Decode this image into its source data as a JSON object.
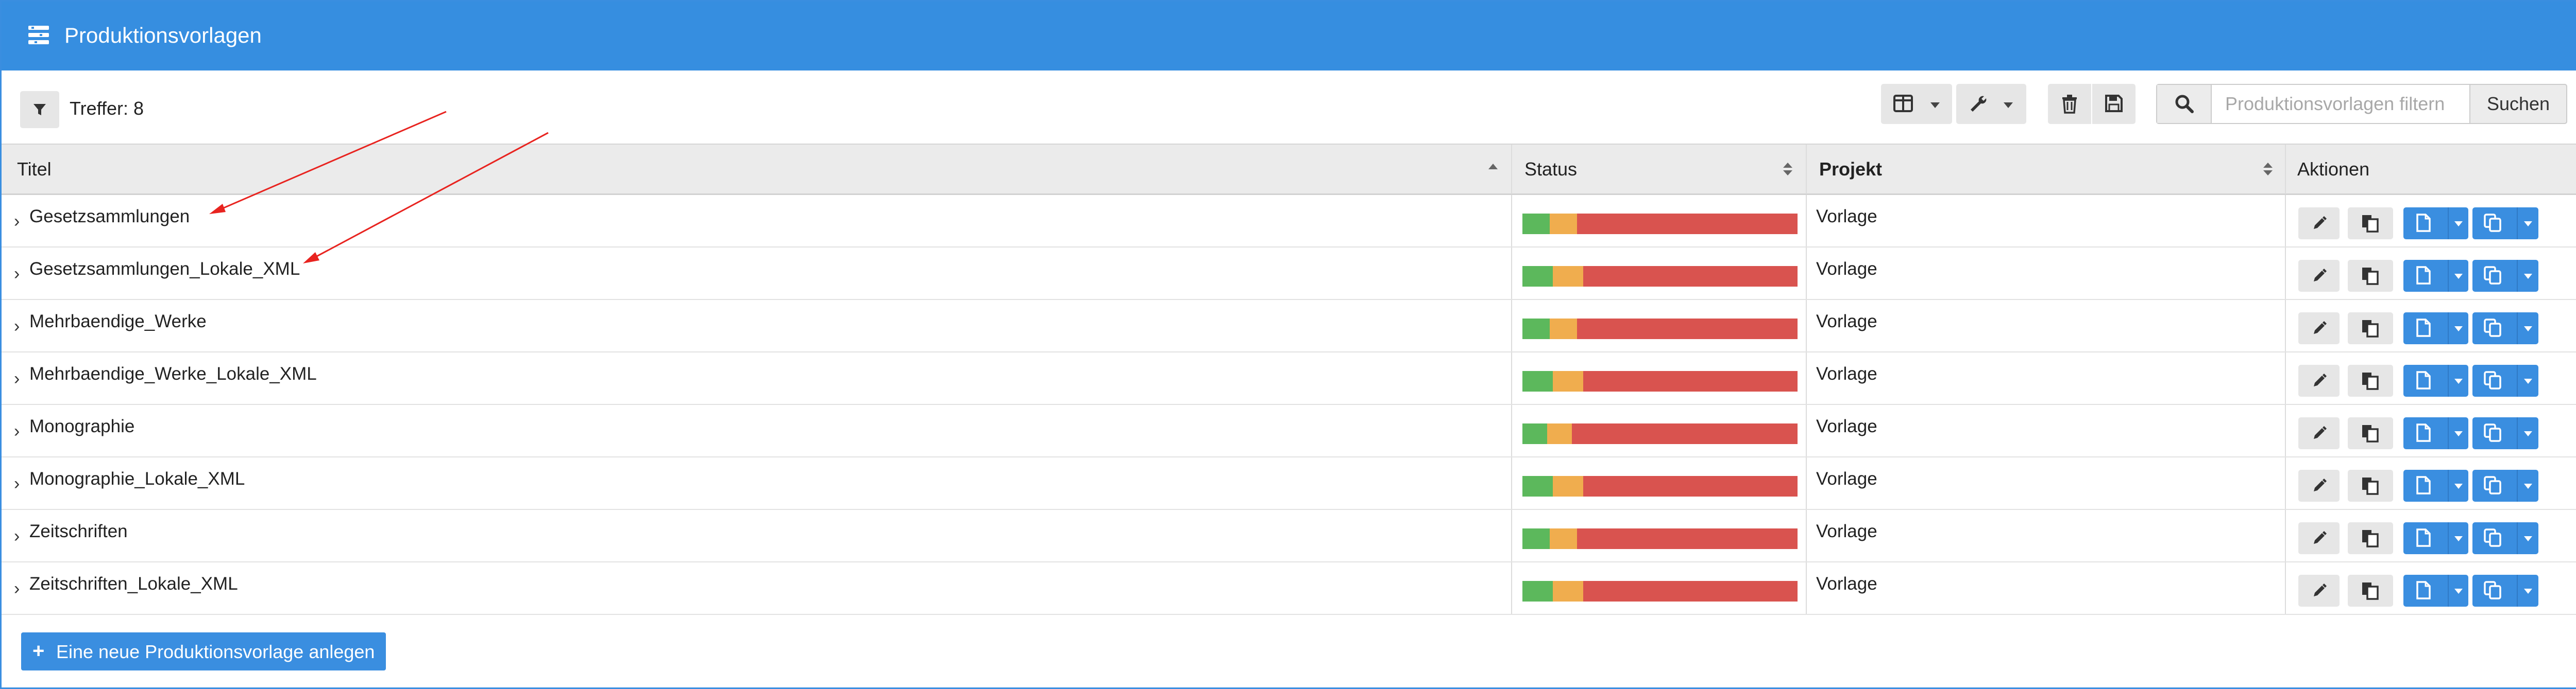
{
  "window": {
    "title": "Produktionsvorlagen",
    "icon": "list-settings-icon"
  },
  "toolbar": {
    "filter_icon": "filter-icon",
    "hits_label": "Treffer: 8",
    "columns_icon": "columns-icon",
    "tools_icon": "wrench-icon",
    "delete_icon": "trash-icon",
    "save_icon": "save-icon",
    "search": {
      "icon": "search-icon",
      "placeholder": "Produktionsvorlagen filtern",
      "value": "",
      "button_label": "Suchen"
    }
  },
  "table": {
    "columns": [
      {
        "label": "Titel",
        "sort": "ascending"
      },
      {
        "label": "Status",
        "sort": "none"
      },
      {
        "label": "Projekt",
        "sort": "none"
      },
      {
        "label": "Aktionen"
      }
    ],
    "rows": [
      {
        "title": "Gesetzsammlungen",
        "project": "Vorlage",
        "status": {
          "done": 0.1,
          "in_progress": 0.1,
          "open": 0.8
        }
      },
      {
        "title": "Gesetzsammlungen_Lokale_XML",
        "project": "Vorlage",
        "status": {
          "done": 0.11,
          "in_progress": 0.11,
          "open": 0.78
        }
      },
      {
        "title": "Mehrbaendige_Werke",
        "project": "Vorlage",
        "status": {
          "done": 0.1,
          "in_progress": 0.1,
          "open": 0.8
        }
      },
      {
        "title": "Mehrbaendige_Werke_Lokale_XML",
        "project": "Vorlage",
        "status": {
          "done": 0.11,
          "in_progress": 0.11,
          "open": 0.78
        }
      },
      {
        "title": "Monographie",
        "project": "Vorlage",
        "status": {
          "done": 0.09,
          "in_progress": 0.09,
          "open": 0.82
        }
      },
      {
        "title": "Monographie_Lokale_XML",
        "project": "Vorlage",
        "status": {
          "done": 0.11,
          "in_progress": 0.11,
          "open": 0.78
        }
      },
      {
        "title": "Zeitschriften",
        "project": "Vorlage",
        "status": {
          "done": 0.1,
          "in_progress": 0.1,
          "open": 0.8
        }
      },
      {
        "title": "Zeitschriften_Lokale_XML",
        "project": "Vorlage",
        "status": {
          "done": 0.11,
          "in_progress": 0.11,
          "open": 0.78
        }
      }
    ],
    "row_expand_icon": "chevron-right-icon",
    "actions": [
      "pencil-icon",
      "copy-icon",
      "file-icon",
      "duplicate-icon"
    ]
  },
  "colors": {
    "accent": "#368ee0",
    "status_done": "#5cb85c",
    "status_progress": "#f0ad4e",
    "status_open": "#d9534f",
    "annotation_arrow": "#e8231f"
  },
  "footer": {
    "new_button_label": "Eine neue Produktionsvorlage anlegen",
    "new_button_icon": "plus-icon"
  }
}
